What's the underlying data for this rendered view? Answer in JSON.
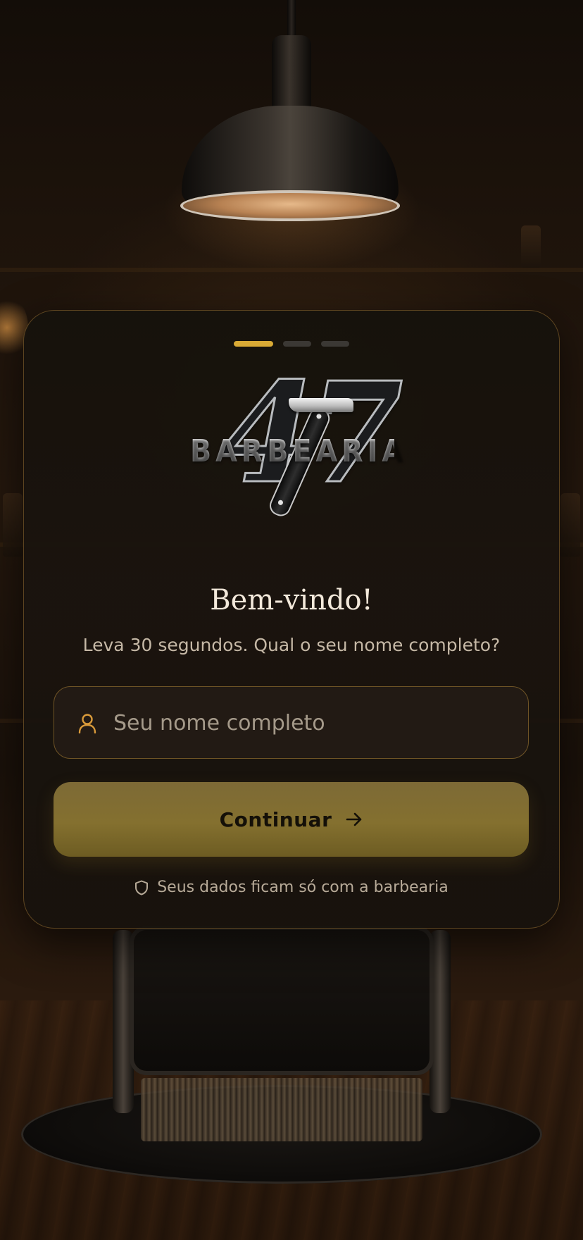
{
  "app": {
    "brand_top": "47",
    "brand_word": "BARBEARIA"
  },
  "onboarding": {
    "step_current": 1,
    "step_total": 3,
    "title": "Bem-vindo!",
    "subtitle": "Leva 30 segundos. Qual o seu nome completo?",
    "name_field": {
      "value": "",
      "placeholder": "Seu nome completo",
      "icon": "user-icon"
    },
    "continue_button": {
      "label": "Continuar",
      "icon": "arrow-right-icon"
    },
    "privacy": {
      "text": "Seus dados ficam só com a barbearia",
      "icon": "shield-icon"
    }
  },
  "colors": {
    "accent": "#d9aa35",
    "button": "#7f6c33",
    "input_border": "#6f5426",
    "card_border": "#96703a"
  }
}
